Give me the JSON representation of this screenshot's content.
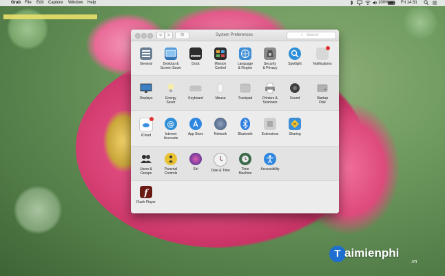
{
  "menubar": {
    "apple_glyph": "",
    "app_name": "Grab",
    "menus": [
      "File",
      "Edit",
      "Capture",
      "Window",
      "Help"
    ],
    "status": {
      "battery": "100%",
      "clock": "Fri 14:31"
    }
  },
  "window": {
    "title": "System Preferences",
    "back_glyph": "<",
    "forward_glyph": ">",
    "grid_glyph": "⊞",
    "search": {
      "glyph": "⌕",
      "placeholder": "Search"
    }
  },
  "sections": [
    {
      "panes": [
        {
          "label": "General",
          "icon": "general-icon",
          "color": "#6a7f93"
        },
        {
          "label": "Desktop &\nScreen Saver",
          "icon": "desktop-icon",
          "color": "#4a86c8"
        },
        {
          "label": "Dock",
          "icon": "dock-icon",
          "color": "#3a3a3a"
        },
        {
          "label": "Mission\nControl",
          "icon": "mission-control-icon",
          "color": "#2e2e2e"
        },
        {
          "label": "Language\n& Region",
          "icon": "language-icon",
          "color": "#3f8fd6"
        },
        {
          "label": "Security\n& Privacy",
          "icon": "security-icon",
          "color": "#8a8a8a"
        },
        {
          "label": "Spotlight",
          "icon": "spotlight-icon",
          "color": "#2f8ed8"
        },
        {
          "label": "Notifications",
          "icon": "notifications-icon",
          "color": "#d8d8d8"
        }
      ]
    },
    {
      "panes": [
        {
          "label": "Displays",
          "icon": "displays-icon",
          "color": "#3b7fc4"
        },
        {
          "label": "Energy\nSaver",
          "icon": "energy-saver-icon",
          "color": "#f0e6a0"
        },
        {
          "label": "Keyboard",
          "icon": "keyboard-icon",
          "color": "#c9c9c9"
        },
        {
          "label": "Mouse",
          "icon": "mouse-icon",
          "color": "#f4f4f4"
        },
        {
          "label": "Trackpad",
          "icon": "trackpad-icon",
          "color": "#bdbdbd"
        },
        {
          "label": "Printers &\nScanners",
          "icon": "printers-icon",
          "color": "#9a9a9a"
        },
        {
          "label": "Sound",
          "icon": "sound-icon",
          "color": "#555555"
        },
        {
          "label": "Startup\nDisk",
          "icon": "startup-disk-icon",
          "color": "#a5a5a5"
        }
      ]
    },
    {
      "panes": [
        {
          "label": "iCloud",
          "icon": "icloud-icon",
          "color": "#ffffff"
        },
        {
          "label": "Internet\nAccounts",
          "icon": "internet-accounts-icon",
          "color": "#2f8ed8"
        },
        {
          "label": "App Store",
          "icon": "app-store-icon",
          "color": "#2f87e0"
        },
        {
          "label": "Network",
          "icon": "network-icon",
          "color": "#5b6f8c"
        },
        {
          "label": "Bluetooth",
          "icon": "bluetooth-icon",
          "color": "#2f7fe0"
        },
        {
          "label": "Extensions",
          "icon": "extensions-icon",
          "color": "#c8c8c8"
        },
        {
          "label": "Sharing",
          "icon": "sharing-icon",
          "color": "#3c8fd6"
        }
      ]
    },
    {
      "panes": [
        {
          "label": "Users &\nGroups",
          "icon": "users-groups-icon",
          "color": "#2b2b2b"
        },
        {
          "label": "Parental\nControls",
          "icon": "parental-controls-icon",
          "color": "#e8c232"
        },
        {
          "label": "Siri",
          "icon": "siri-icon",
          "color": "#6a3fb5"
        },
        {
          "label": "Date & Time",
          "icon": "date-time-icon",
          "color": "#f2f2f2"
        },
        {
          "label": "Time\nMachine",
          "icon": "time-machine-icon",
          "color": "#3a6a4a"
        },
        {
          "label": "Accessibility",
          "icon": "accessibility-icon",
          "color": "#2f87e0"
        }
      ]
    },
    {
      "panes": [
        {
          "label": "Flash Player",
          "icon": "flash-player-icon",
          "color": "#6b1a14"
        }
      ]
    }
  ],
  "watermark": {
    "brand": "aimienphi",
    "letter": "T",
    "tld": ".vn"
  }
}
